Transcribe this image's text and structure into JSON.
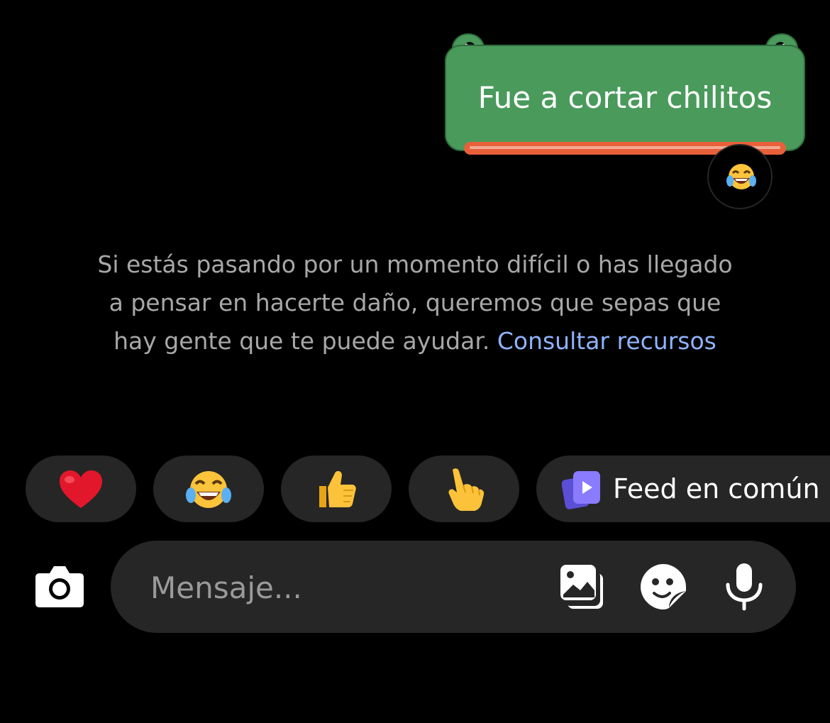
{
  "message": {
    "text": "Fue a cortar chilitos",
    "bubble_color": "#4a9a5c",
    "underline_color": "#e8603a",
    "reaction": "face-with-tears-of-joy"
  },
  "safety_notice": {
    "text": "Si estás pasando por un momento difícil o has llegado a pensar en hacerte daño, queremos que sepas que hay gente que te puede ayudar. ",
    "link_label": "Consultar recursos",
    "link_color": "#8fb4ff"
  },
  "quick_replies": [
    {
      "icon": "red-heart"
    },
    {
      "icon": "face-with-tears-of-joy"
    },
    {
      "icon": "thumbs-up"
    },
    {
      "icon": "pointing-hand"
    },
    {
      "icon": "feed-icon",
      "label": "Feed en común"
    }
  ],
  "composer": {
    "placeholder": "Mensaje...",
    "value": "",
    "icons": [
      "camera-icon",
      "gallery-icon",
      "sticker-icon",
      "microphone-icon"
    ]
  }
}
